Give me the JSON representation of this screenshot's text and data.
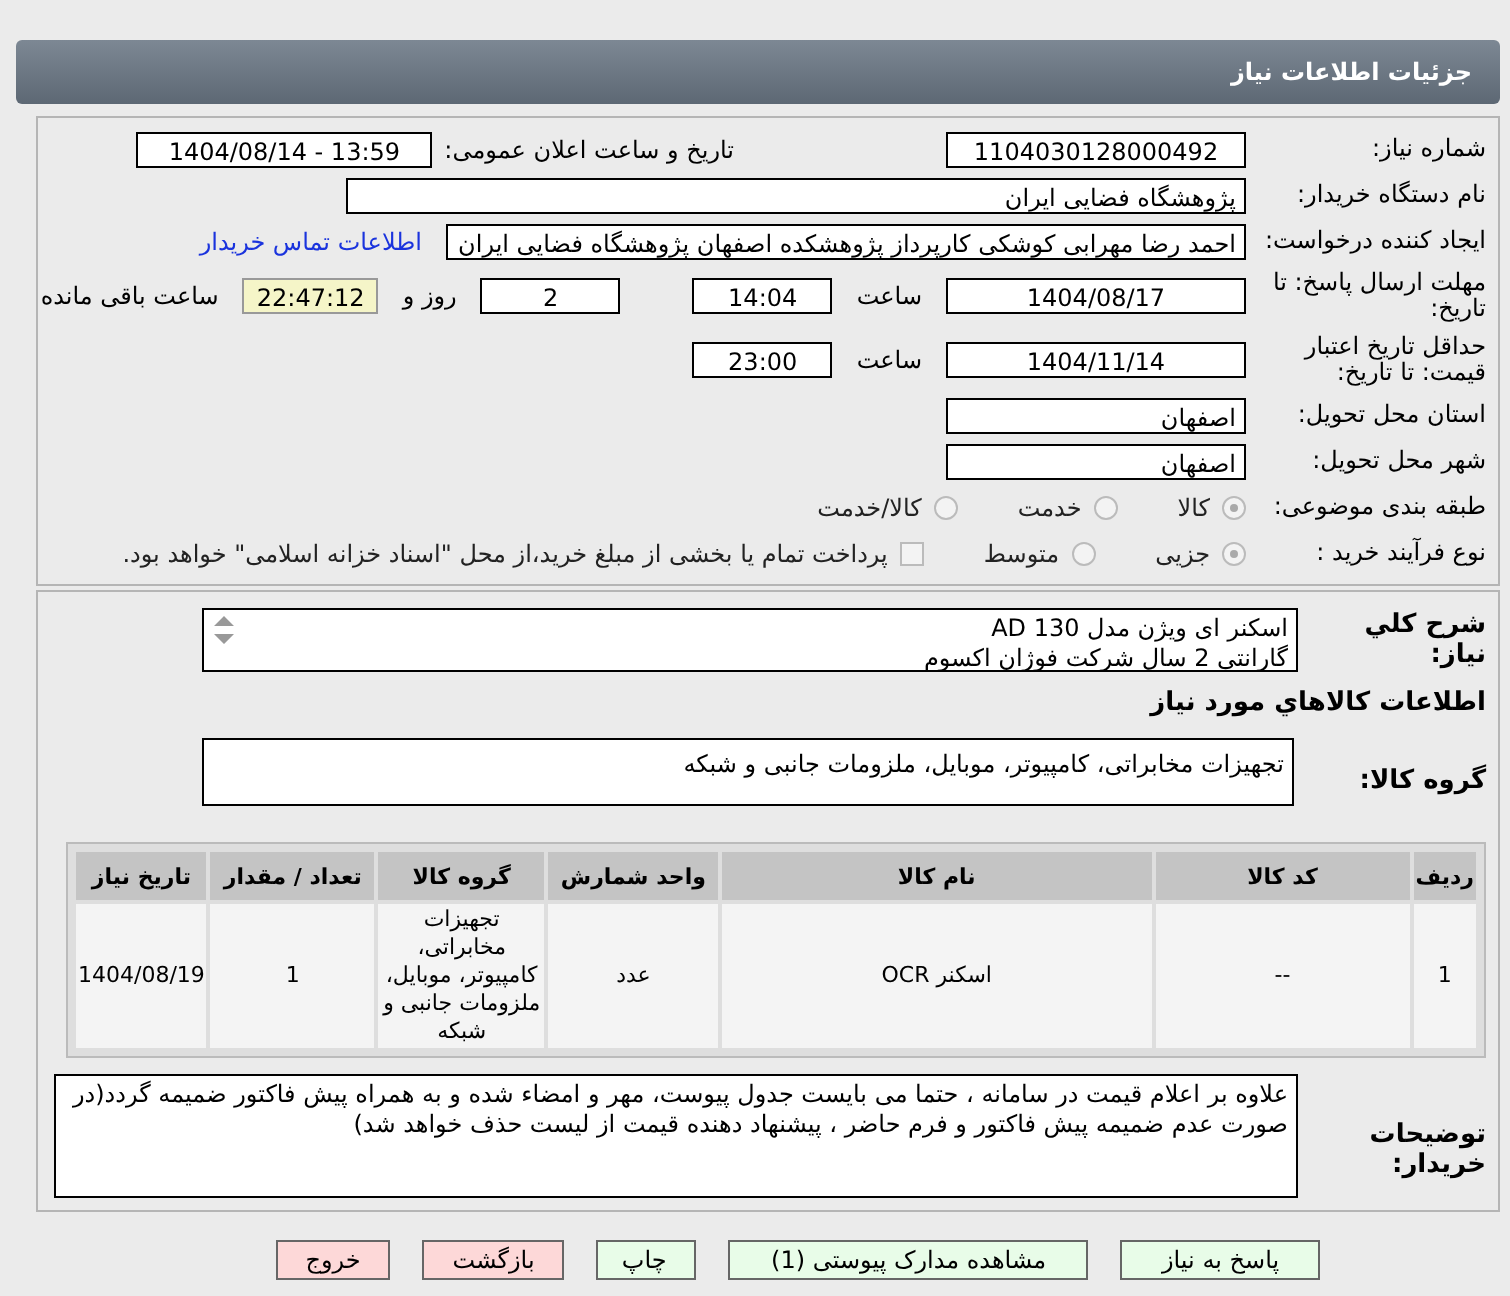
{
  "header": {
    "title": "جزئیات اطلاعات نیاز"
  },
  "details": {
    "need_number": {
      "label": "شماره نیاز:",
      "value": "1104030128000492"
    },
    "announce": {
      "label": "تاریخ و ساعت اعلان عمومی:",
      "value": "1404/08/14 - 13:59"
    },
    "buyer": {
      "label": "نام دستگاه خریدار:",
      "value": "پژوهشگاه فضایی ایران"
    },
    "creator": {
      "label": "ایجاد کننده درخواست:",
      "value": "احمد رضا مهرابی کوشکی کارپرداز پژوهشکده اصفهان پژوهشگاه فضایی ایران",
      "link": "اطلاعات تماس خریدار"
    },
    "deadline": {
      "label": "مهلت ارسال پاسخ: تا تاریخ:",
      "date": "1404/08/17",
      "time_label": "ساعت",
      "time": "14:04",
      "days": "2",
      "days_label": "روز و",
      "remaining": "22:47:12",
      "remaining_label": "ساعت باقی مانده"
    },
    "validity": {
      "label": "حداقل تاریخ اعتبار قیمت: تا تاریخ:",
      "date": "1404/11/14",
      "time_label": "ساعت",
      "time": "23:00"
    },
    "province": {
      "label": "استان محل تحویل:",
      "value": "اصفهان"
    },
    "city": {
      "label": "شهر محل تحویل:",
      "value": "اصفهان"
    },
    "category": {
      "label": "طبقه بندی موضوعی:",
      "options": [
        {
          "label": "کالا",
          "selected": true
        },
        {
          "label": "خدمت",
          "selected": false
        },
        {
          "label": "کالا/خدمت",
          "selected": false
        }
      ]
    },
    "process": {
      "label": "نوع فرآیند خرید :",
      "options": [
        {
          "label": "جزیی",
          "selected": true
        },
        {
          "label": "متوسط",
          "selected": false
        }
      ],
      "payment": {
        "label": "پرداخت تمام یا بخشی از مبلغ خرید،از محل \"اسناد خزانه اسلامی\" خواهد بود.",
        "checked": false
      }
    }
  },
  "needs": {
    "description": {
      "label": "شرح کلي نياز:",
      "value": "اسکنر ای ویژن مدل AD 130\nگارانتی 2 سال شرکت فوژان اکسوم"
    },
    "goods_heading": "اطلاعات کالاهاي مورد نياز",
    "group": {
      "label": "گروه کالا:",
      "value": "تجهیزات مخابراتی، کامپیوتر، موبایل، ملزومات جانبی و شبکه"
    },
    "table": {
      "columns": [
        "ردیف",
        "کد کالا",
        "نام کالا",
        "واحد شمارش",
        "گروه کالا",
        "تعداد / مقدار",
        "تاریخ نیاز"
      ],
      "rows": [
        [
          "1",
          "--",
          "اسکنر OCR",
          "عدد",
          "تجهیزات مخابراتی، کامپیوتر، موبایل، ملزومات جانبی و شبکه",
          "1",
          "1404/08/19"
        ]
      ]
    },
    "notes": {
      "label": "توضیحات خریدار:",
      "value": "علاوه بر اعلام قیمت در سامانه ، حتما می بایست جدول پیوست، مهر و امضاء شده و به همراه پیش فاکتور ضمیمه گردد(در صورت عدم ضمیمه پیش فاکتور و فرم حاضر ، پیشنهاد دهنده قیمت از لیست حذف خواهد شد)"
    }
  },
  "buttons": [
    {
      "label": "پاسخ به نیاز",
      "kind": "action"
    },
    {
      "label": "مشاهده مدارک پیوستی (1)",
      "kind": "action"
    },
    {
      "label": "چاپ",
      "kind": "action"
    },
    {
      "label": "بازگشت",
      "kind": "exit"
    },
    {
      "label": "خروج",
      "kind": "exit"
    }
  ]
}
